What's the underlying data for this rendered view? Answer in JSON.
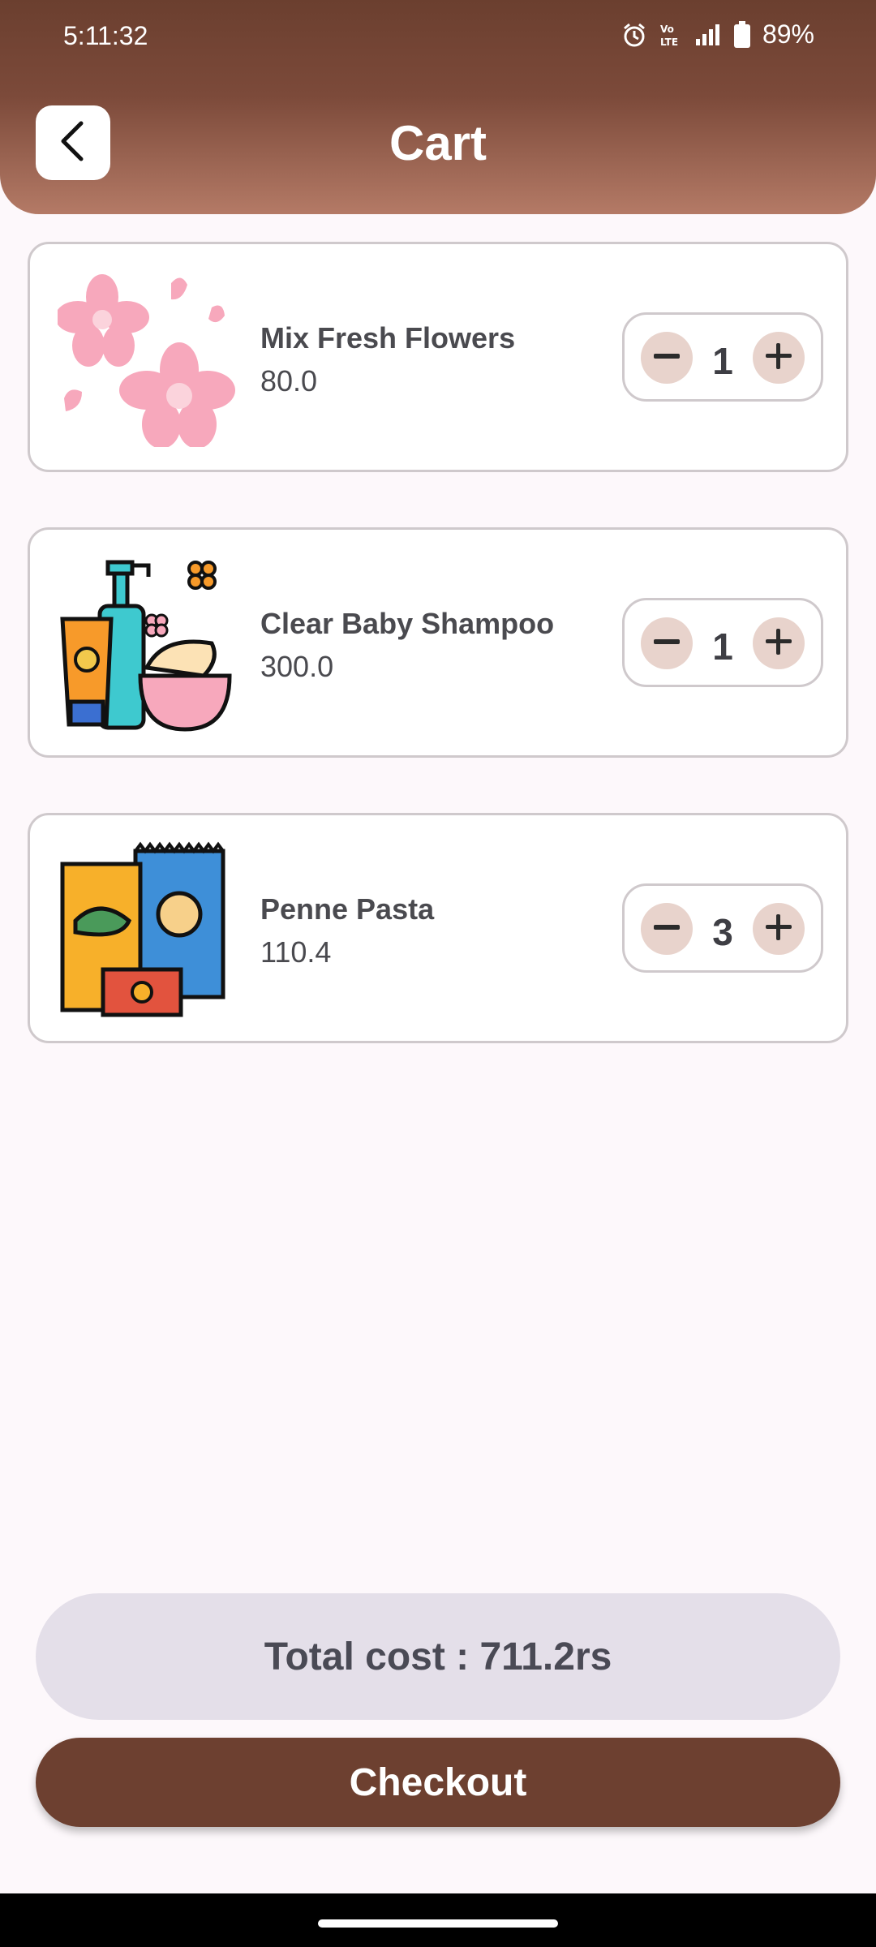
{
  "status_bar": {
    "time": "5:11:32",
    "battery": "89%",
    "icons": [
      "alarm-icon",
      "volte-icon",
      "signal-icon",
      "battery-icon"
    ]
  },
  "header": {
    "title": "Cart",
    "back_icon": "chevron-left-icon"
  },
  "cart": {
    "items": [
      {
        "name": "Mix Fresh Flowers",
        "price": "80.0",
        "quantity": "1",
        "image": "flowers-image"
      },
      {
        "name": "Clear Baby Shampoo",
        "price": "300.0",
        "quantity": "1",
        "image": "shampoo-image"
      },
      {
        "name": "Penne Pasta",
        "price": "110.4",
        "quantity": "3",
        "image": "snacks-image"
      }
    ]
  },
  "summary": {
    "total_text": "Total cost : 711.2rs",
    "checkout_label": "Checkout"
  },
  "colors": {
    "brand_brown": "#6d4030",
    "header_gradient_end": "#b47a66",
    "stepper_button": "#e8d3cc",
    "total_bg": "#e4dfe9"
  }
}
